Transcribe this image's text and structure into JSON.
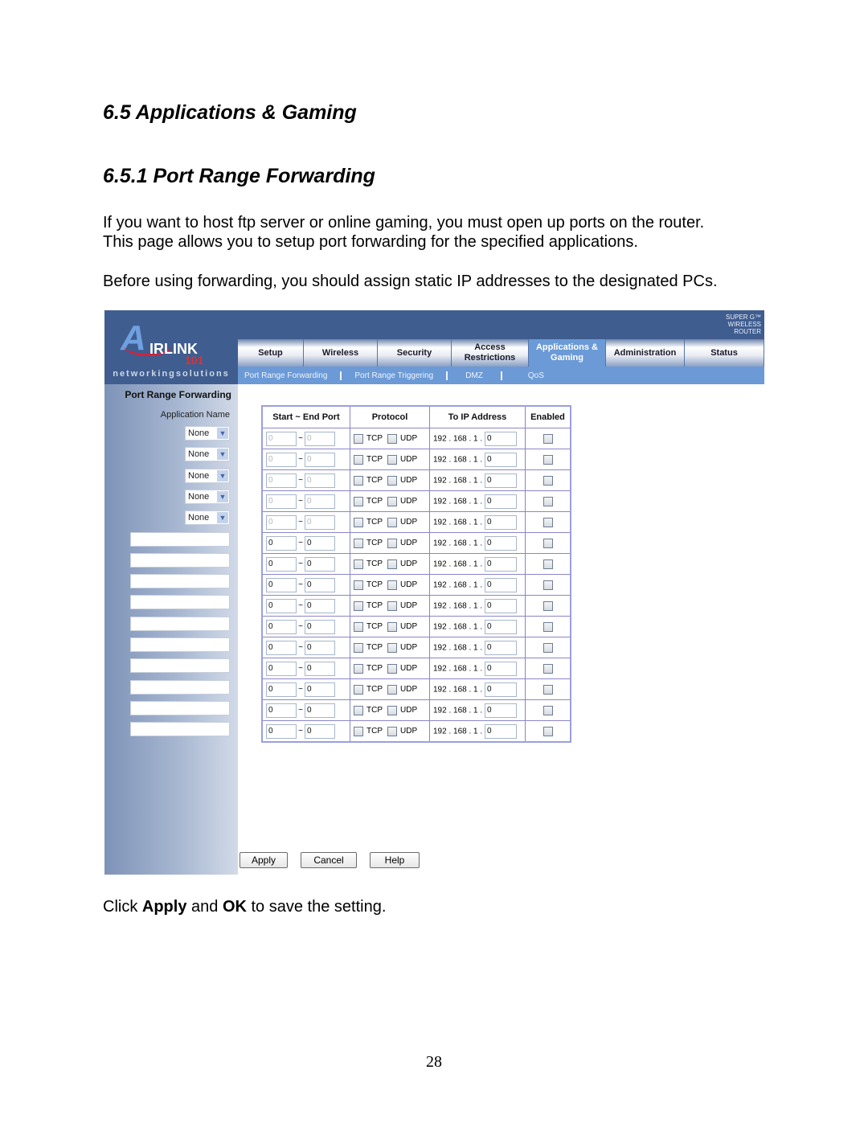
{
  "doc": {
    "heading1": "6.5 Applications & Gaming",
    "heading2": "6.5.1 Port Range Forwarding",
    "para1_line1": "If you want to host ftp server or online gaming, you must open up ports on the router.",
    "para1_line2": "This page allows you to setup port forwarding for the specified applications.",
    "para2": "Before using forwarding, you should assign static IP addresses to the designated PCs.",
    "para3": {
      "pre": "Click ",
      "b1": "Apply",
      "mid": " and ",
      "b2": "OK",
      "post": " to save the setting."
    },
    "page_number": "28"
  },
  "router": {
    "logo": {
      "a": "A",
      "irlink": "IRLINK",
      "num": "101",
      "tm": "™"
    },
    "tagline": "networkingsolutions",
    "badge": {
      "line1": "SUPER G™",
      "line2": "WIRELESS ROUTER"
    },
    "tabs": [
      {
        "label": "Setup",
        "active": false
      },
      {
        "label": "Wireless",
        "active": false
      },
      {
        "label": "Security",
        "active": false
      },
      {
        "label": "Access Restrictions",
        "active": false
      },
      {
        "label": "Applications & Gaming",
        "active": true
      },
      {
        "label": "Administration",
        "active": false
      },
      {
        "label": "Status",
        "active": false
      }
    ],
    "subnav": [
      "Port Range Forwarding",
      "Port Range Triggering",
      "DMZ",
      "QoS"
    ],
    "sidebar": {
      "title": "Port Range Forwarding",
      "label": "Application Name"
    },
    "table": {
      "headers": [
        "Start ~ End Port",
        "Protocol",
        "To IP Address",
        "Enabled"
      ],
      "tcp_label": "TCP",
      "udp_label": "UDP",
      "ip_prefix": "192 . 168 . 1 .",
      "tilde": "~",
      "rows": [
        {
          "app": "None",
          "type": "select",
          "start": "0",
          "end": "0",
          "ip": "0",
          "disabled": true
        },
        {
          "app": "None",
          "type": "select",
          "start": "0",
          "end": "0",
          "ip": "0",
          "disabled": true
        },
        {
          "app": "None",
          "type": "select",
          "start": "0",
          "end": "0",
          "ip": "0",
          "disabled": true
        },
        {
          "app": "None",
          "type": "select",
          "start": "0",
          "end": "0",
          "ip": "0",
          "disabled": true
        },
        {
          "app": "None",
          "type": "select",
          "start": "0",
          "end": "0",
          "ip": "0",
          "disabled": true
        },
        {
          "app": "",
          "type": "text",
          "start": "0",
          "end": "0",
          "ip": "0",
          "disabled": false
        },
        {
          "app": "",
          "type": "text",
          "start": "0",
          "end": "0",
          "ip": "0",
          "disabled": false
        },
        {
          "app": "",
          "type": "text",
          "start": "0",
          "end": "0",
          "ip": "0",
          "disabled": false
        },
        {
          "app": "",
          "type": "text",
          "start": "0",
          "end": "0",
          "ip": "0",
          "disabled": false
        },
        {
          "app": "",
          "type": "text",
          "start": "0",
          "end": "0",
          "ip": "0",
          "disabled": false
        },
        {
          "app": "",
          "type": "text",
          "start": "0",
          "end": "0",
          "ip": "0",
          "disabled": false
        },
        {
          "app": "",
          "type": "text",
          "start": "0",
          "end": "0",
          "ip": "0",
          "disabled": false
        },
        {
          "app": "",
          "type": "text",
          "start": "0",
          "end": "0",
          "ip": "0",
          "disabled": false
        },
        {
          "app": "",
          "type": "text",
          "start": "0",
          "end": "0",
          "ip": "0",
          "disabled": false
        },
        {
          "app": "",
          "type": "text",
          "start": "0",
          "end": "0",
          "ip": "0",
          "disabled": false
        }
      ]
    },
    "buttons": {
      "apply": "Apply",
      "cancel": "Cancel",
      "help": "Help"
    }
  }
}
